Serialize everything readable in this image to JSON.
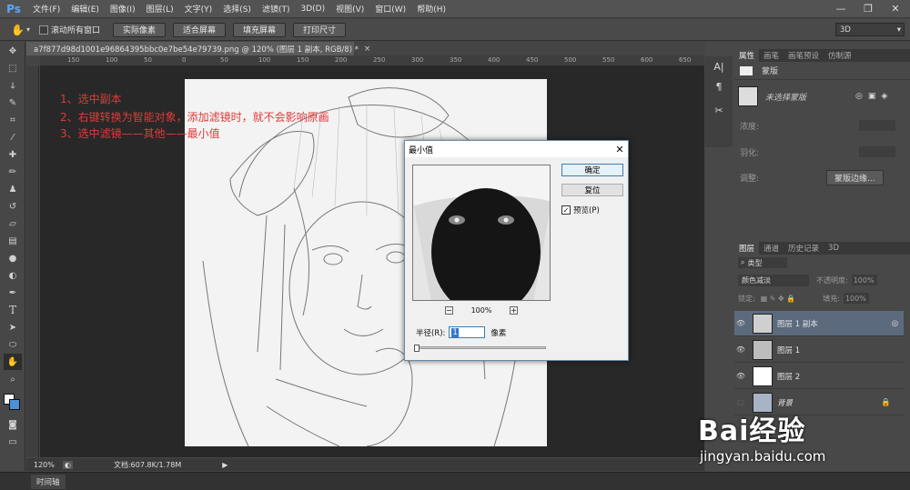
{
  "app": {
    "logo": "Ps"
  },
  "menu": [
    "文件(F)",
    "编辑(E)",
    "图像(I)",
    "图层(L)",
    "文字(Y)",
    "选择(S)",
    "滤镜(T)",
    "3D(D)",
    "视图(V)",
    "窗口(W)",
    "帮助(H)"
  ],
  "window_controls": {
    "minimize": "—",
    "restore": "❐",
    "close": "✕"
  },
  "options": {
    "scroll_all": "滚动所有窗口",
    "buttons": [
      "实际像素",
      "适合屏幕",
      "填充屏幕",
      "打印尺寸"
    ],
    "workspace": "3D"
  },
  "document": {
    "tab_title": "a7f877d98d1001e96864395bbc0e7be54e79739.png @ 120% (图层 1 副本, RGB/8) *",
    "ruler_ticks": [
      "150",
      "100",
      "50",
      "0",
      "50",
      "100",
      "150",
      "200",
      "250",
      "300",
      "350",
      "400",
      "450",
      "500",
      "550",
      "600",
      "650"
    ]
  },
  "notes": [
    "1、选中副本",
    "2、右键转换为智能对象，添加滤镜时，就不会影响原画",
    "3、选中滤镜——其他——最小值"
  ],
  "status": {
    "zoom": "120%",
    "doc": "文档:607.8K/1.78M"
  },
  "timeline": {
    "label": "时间轴"
  },
  "properties_panel": {
    "tabs": [
      "属性",
      "画笔",
      "画笔预设",
      "仿制源"
    ],
    "mask_label": "蒙版",
    "no_mask": "未选择蒙版",
    "density": "浓度:",
    "feather": "羽化:",
    "adjust": "调整:",
    "mask_edge": "蒙版边缘..."
  },
  "layers_panel": {
    "tabs": [
      "图层",
      "通道",
      "历史记录",
      "3D"
    ],
    "kind": "类型",
    "blend_mode": "颜色减淡",
    "opacity_label": "不透明度:",
    "opacity": "100%",
    "lock_label": "锁定:",
    "fill_label": "填充:",
    "fill": "100%",
    "layers": [
      {
        "name": "图层 1 副本",
        "selected": true,
        "visible": true
      },
      {
        "name": "图层 1",
        "selected": false,
        "visible": true
      },
      {
        "name": "图层 2",
        "selected": false,
        "visible": true
      },
      {
        "name": "背景",
        "selected": false,
        "visible": false
      }
    ]
  },
  "dialog": {
    "title": "最小值",
    "ok": "确定",
    "reset": "复位",
    "preview_label": "预览(P)",
    "zoom": "100%",
    "radius_label": "半径(R):",
    "radius_value": "1",
    "unit": "像素"
  },
  "watermark": {
    "brand": "Bai经验",
    "url": "jingyan.baidu.com"
  }
}
